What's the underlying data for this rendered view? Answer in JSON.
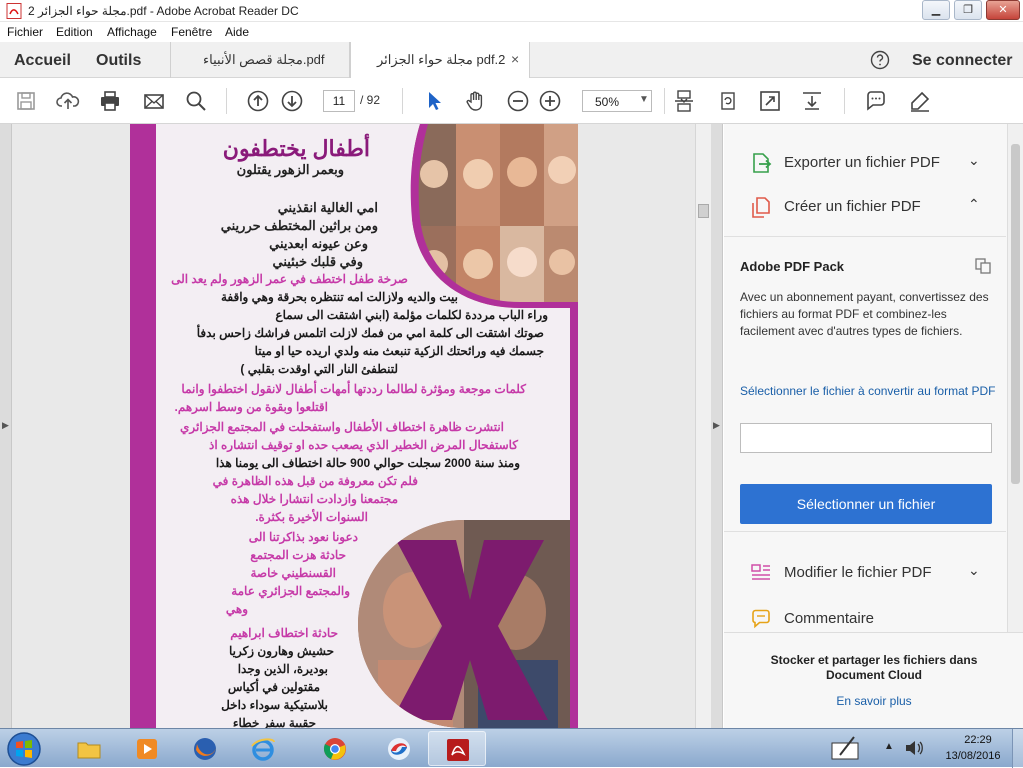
{
  "window": {
    "title": "مجلة حواء الجزائر 2.pdf - Adobe Acrobat Reader DC",
    "controls": {
      "minimize": "▁",
      "maximize": "❐",
      "close": "✕"
    }
  },
  "menu": {
    "items": [
      "Fichier",
      "Edition",
      "Affichage",
      "Fenêtre",
      "Aide"
    ]
  },
  "tabs": {
    "home": "Accueil",
    "tools": "Outils",
    "documents": [
      {
        "label": "مجلة قصص الأنبياء.pdf",
        "active": false
      },
      {
        "label": "مجلة حواء الجزائر pdf.2",
        "active": true
      }
    ],
    "close_glyph": "×",
    "sign_in": "Se connecter"
  },
  "toolbar": {
    "page_current": "11",
    "page_total": "/ 92",
    "zoom": "50%",
    "zoom_caret": "▼"
  },
  "document": {
    "title": "أطفال يختطفون",
    "subtitle": "وبعمر الزهور يقتلون",
    "poem": [
      "امي الغالية انقذيني",
      "ومن براثين المختطف حرريني",
      "وعن عيونه ابعديني",
      "وفي قلبك خبئيني"
    ],
    "para1": [
      "صرخة طفل اختطف في عمر الزهور ولم يعد الى",
      "بيت والديه ولازالت امه تنتظره بحرقة وهي واقفة",
      "وراء الباب مرددة لكلمات مؤلمة (ابني اشتقت الى سماع",
      "صوتك اشتقت الى كلمة امي من فمك لازلت اتلمس فراشك زاحس بدفأ",
      "جسمك فيه ورائحتك الزكية تنبعث منه ولدي اريده حيا او ميتا",
      "لتنطفئ النار التي اوقدت بقلبي )"
    ],
    "para2": [
      "كلمات موجعة ومؤثرة لطالما رددتها أمهات أطفال لانقول اختطفوا وانما",
      "اقتلعوا وبقوة من وسط اسرهم."
    ],
    "para3": [
      "انتشرت ظاهرة اختطاف الأطفال واستفحلت في المجتمع الجزائري",
      "كاستفحال المرض الخطير الذي يصعب حده او توقيف انتشاره اذ",
      "ومنذ سنة 2000 سجلت حوالي 900 حالة اختطاف الى يومنا هذا",
      "فلم تكن معروفة من قبل هذه الظاهرة في",
      "مجتمعنا وازدادت انتشارا خلال هذه",
      "السنوات الأخيرة بكثرة."
    ],
    "para4": [
      "دعونا نعود بذاكرتنا الى",
      "حادثة هزت المجتمع",
      "القسنطيني خاصة",
      "والمجتمع الجزائري عامة",
      "وهي"
    ],
    "para5": [
      "حادثة اختطاف ابراهيم",
      "حشيش وهارون زكريا",
      "بوديرة، الذين وجدا",
      "مقتولين في أكياس",
      "بلاستيكية سوداء داخل",
      "حقيبة سفر خطاء"
    ]
  },
  "panel": {
    "export_label": "Exporter un fichier PDF",
    "create_label": "Créer un fichier PDF",
    "pack_title": "Adobe PDF Pack",
    "pack_desc": "Avec un abonnement payant, convertissez des fichiers au format PDF et combinez-les facilement avec d'autres types de fichiers.",
    "pack_link": "Sélectionner le fichier à convertir au format PDF",
    "pack_button": "Sélectionner un fichier",
    "modify_label": "Modifier le fichier PDF",
    "comment_label": "Commentaire",
    "store_text": "Stocker et partager les fichiers dans Document Cloud",
    "store_link": "En savoir plus",
    "chev_down": "⌄",
    "chev_up": "⌃"
  },
  "taskbar": {
    "time": "22:29",
    "date": "13/08/2016"
  },
  "colors": {
    "accent": "#2d72d2",
    "magenta": "#b0309a",
    "link": "#1a5fa8"
  }
}
